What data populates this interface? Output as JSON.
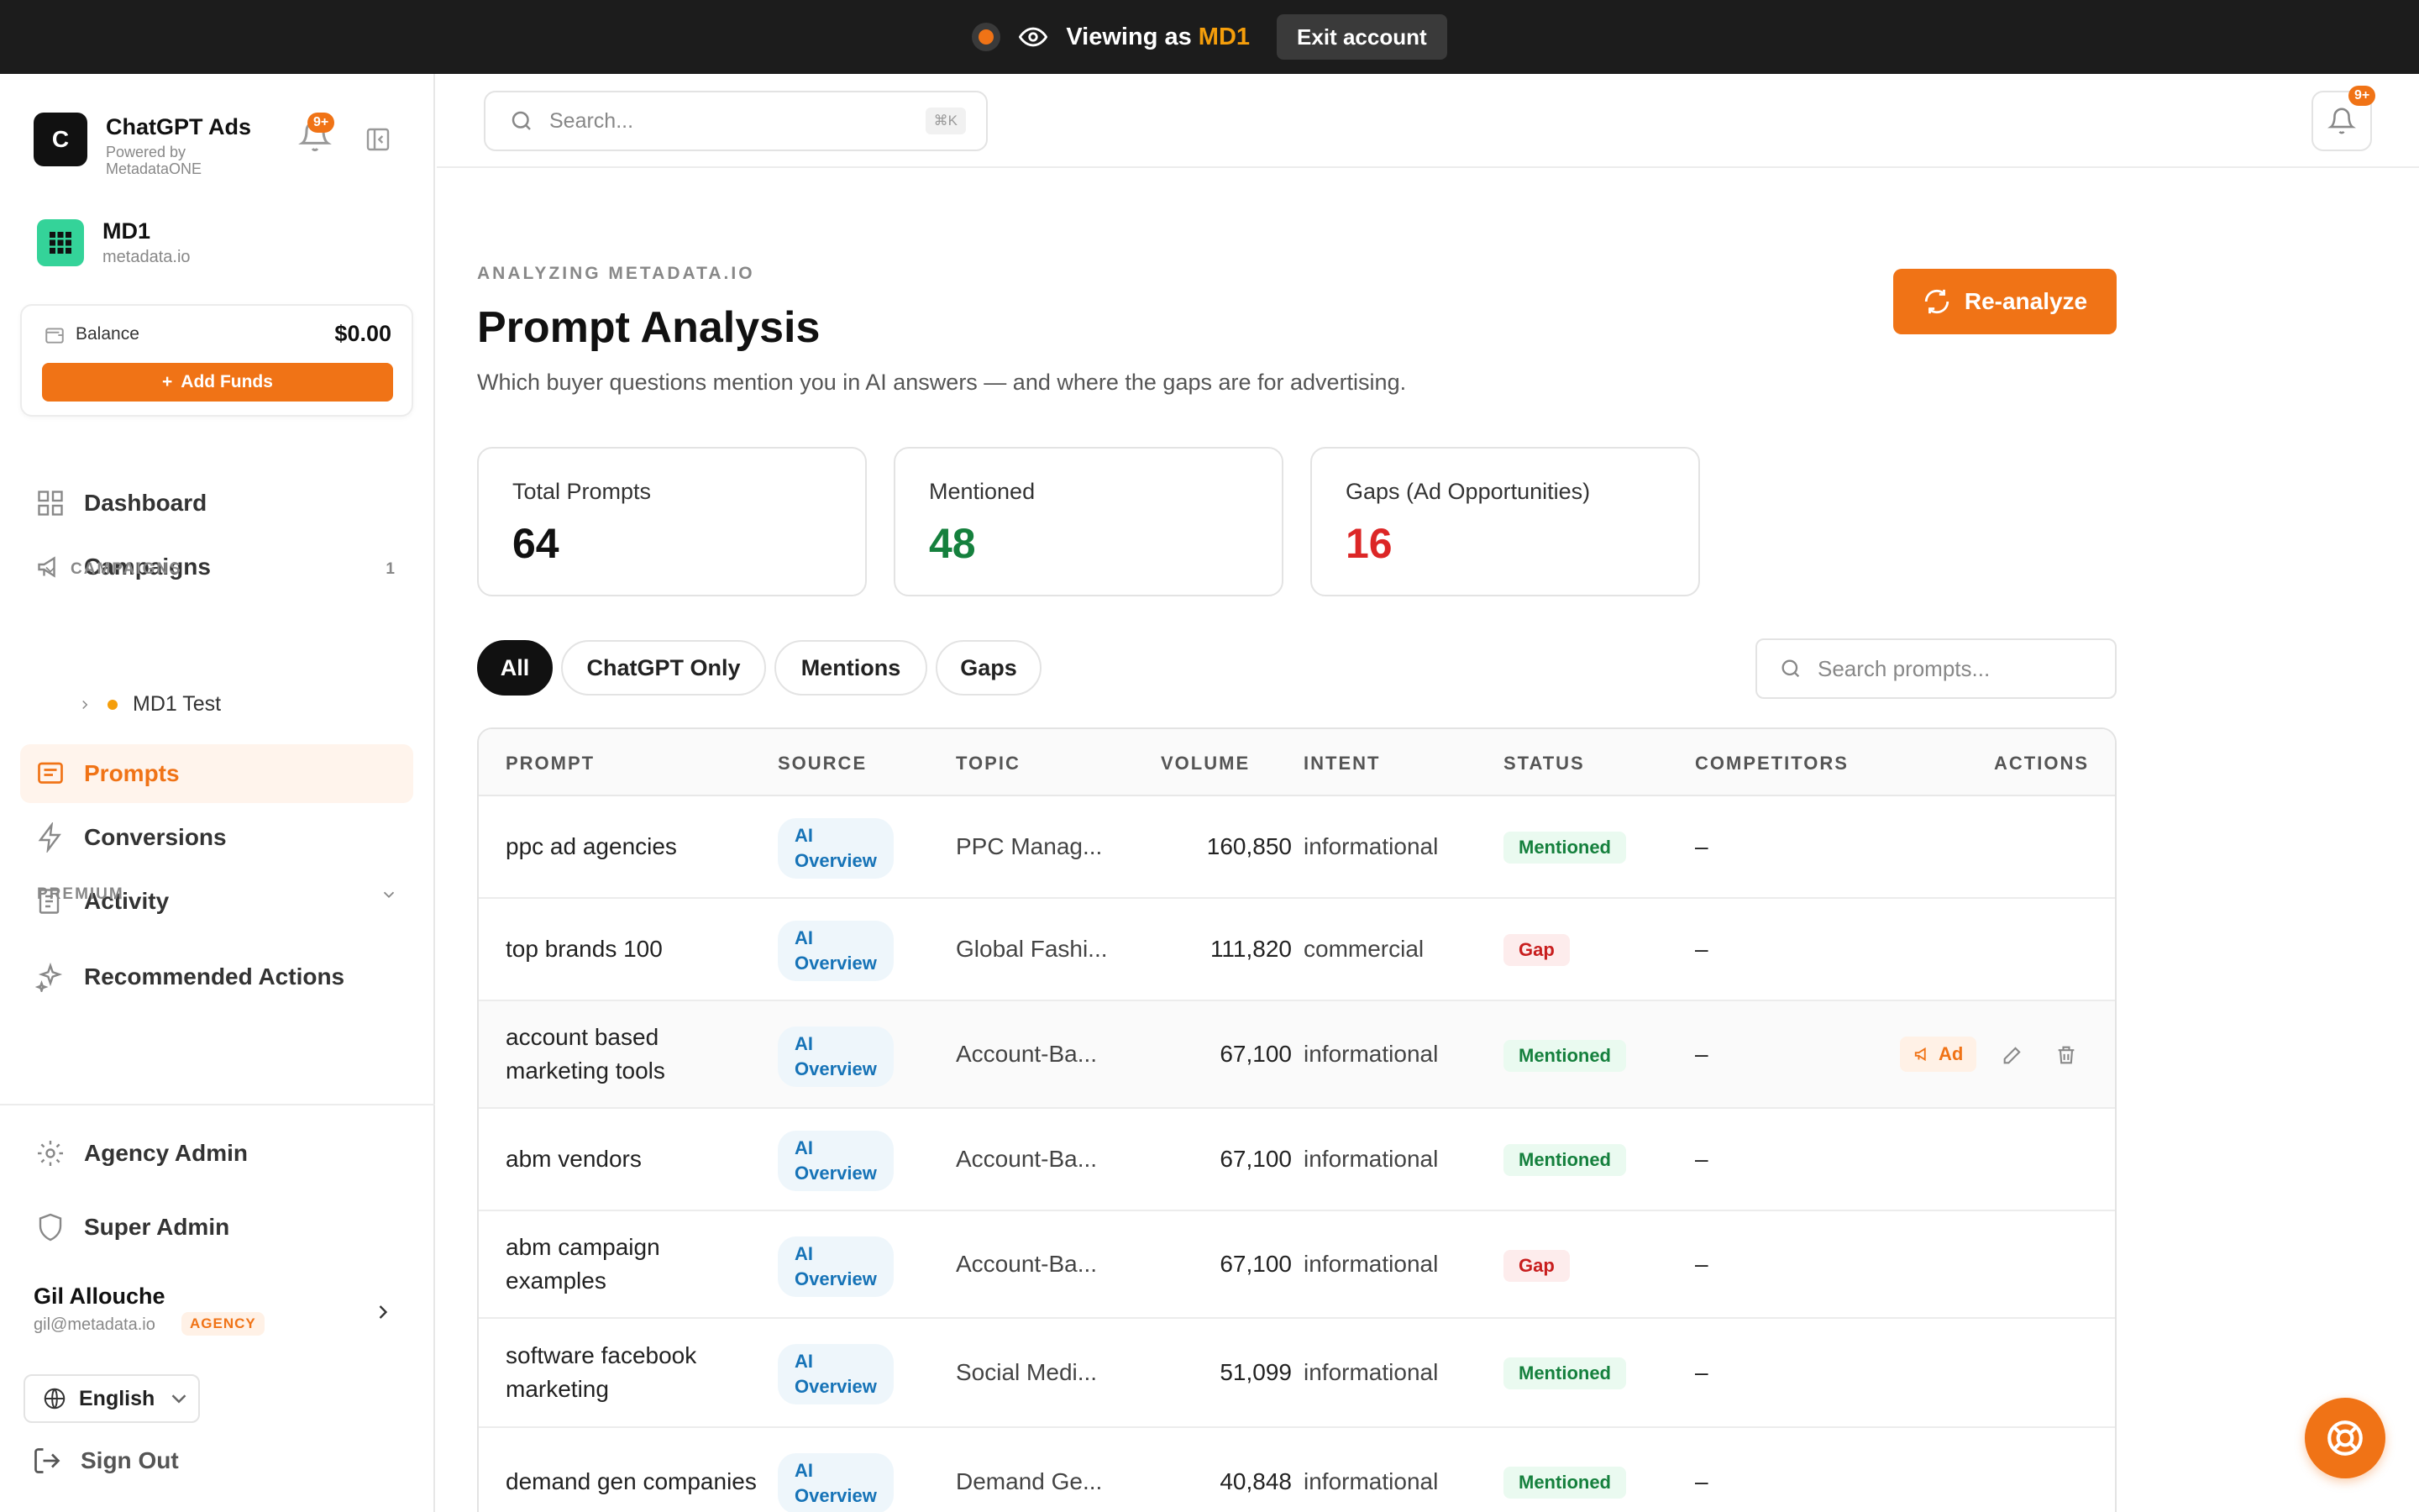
{
  "banner": {
    "viewing_prefix": "Viewing as",
    "viewing_account": "MD1",
    "exit_label": "Exit account"
  },
  "brand": {
    "logo_letter": "C",
    "name": "ChatGPT Ads",
    "powered_by": "Powered by MetadataONE",
    "notif_badge": "9+"
  },
  "account": {
    "name": "MD1",
    "domain": "metadata.io"
  },
  "balance": {
    "label": "Balance",
    "amount": "$0.00",
    "add_funds_label": "Add Funds"
  },
  "nav": {
    "dashboard": "Dashboard",
    "campaigns": "Campaigns",
    "campaigns_header": "CAMPAIGNS",
    "campaigns_count": "1",
    "campaign_item": "MD1 Test",
    "prompts": "Prompts",
    "conversions": "Conversions",
    "activity": "Activity",
    "premium_label": "PREMIUM",
    "recommended_actions": "Recommended Actions",
    "agency_admin": "Agency Admin",
    "super_admin": "Super Admin",
    "sign_out": "Sign Out"
  },
  "user": {
    "name": "Gil Allouche",
    "email": "gil@metadata.io",
    "badge": "AGENCY",
    "language": "English"
  },
  "header": {
    "search_placeholder": "Search...",
    "search_shortcut": "⌘K",
    "notif_badge": "9+"
  },
  "page": {
    "eyebrow": "ANALYZING METADATA.IO",
    "title": "Prompt Analysis",
    "description": "Which buyer questions mention you in AI answers — and where the gaps are for advertising.",
    "reanalyze_label": "Re-analyze"
  },
  "stats": {
    "total_label": "Total Prompts",
    "total_value": "64",
    "mentioned_label": "Mentioned",
    "mentioned_value": "48",
    "gaps_label": "Gaps (Ad Opportunities)",
    "gaps_value": "16"
  },
  "colors": {
    "accent": "#f07316",
    "mentioned": "#15803d",
    "gap": "#dc2626"
  },
  "filters": {
    "all": "All",
    "chatgpt_only": "ChatGPT Only",
    "mentions": "Mentions",
    "gaps": "Gaps",
    "search_placeholder": "Search prompts..."
  },
  "table": {
    "columns": {
      "prompt": "PROMPT",
      "source": "SOURCE",
      "topic": "TOPIC",
      "volume": "VOLUME",
      "intent": "INTENT",
      "status": "STATUS",
      "competitors": "COMPETITORS",
      "actions": "ACTIONS"
    },
    "ad_label": "Ad",
    "rows": [
      {
        "prompt": "ppc ad agencies",
        "source_1": "AI",
        "source_2": "Overview",
        "topic": "PPC Manag...",
        "volume": "160,850",
        "intent": "informational",
        "status": "Mentioned",
        "competitors": "–"
      },
      {
        "prompt": "top brands 100",
        "source_1": "AI",
        "source_2": "Overview",
        "topic": "Global Fashi...",
        "volume": "111,820",
        "intent": "commercial",
        "status": "Gap",
        "competitors": "–"
      },
      {
        "prompt": "account based marketing tools",
        "source_1": "AI",
        "source_2": "Overview",
        "topic": "Account-Ba...",
        "volume": "67,100",
        "intent": "informational",
        "status": "Mentioned",
        "competitors": "–"
      },
      {
        "prompt": "abm vendors",
        "source_1": "AI",
        "source_2": "Overview",
        "topic": "Account-Ba...",
        "volume": "67,100",
        "intent": "informational",
        "status": "Mentioned",
        "competitors": "–"
      },
      {
        "prompt": "abm campaign examples",
        "source_1": "AI",
        "source_2": "Overview",
        "topic": "Account-Ba...",
        "volume": "67,100",
        "intent": "informational",
        "status": "Gap",
        "competitors": "–"
      },
      {
        "prompt": "software facebook marketing",
        "source_1": "AI",
        "source_2": "Overview",
        "topic": "Social Medi...",
        "volume": "51,099",
        "intent": "informational",
        "status": "Mentioned",
        "competitors": "–"
      },
      {
        "prompt": "demand gen companies",
        "source_1": "AI",
        "source_2": "Overview",
        "topic": "Demand Ge...",
        "volume": "40,848",
        "intent": "informational",
        "status": "Mentioned",
        "competitors": "–"
      }
    ]
  }
}
